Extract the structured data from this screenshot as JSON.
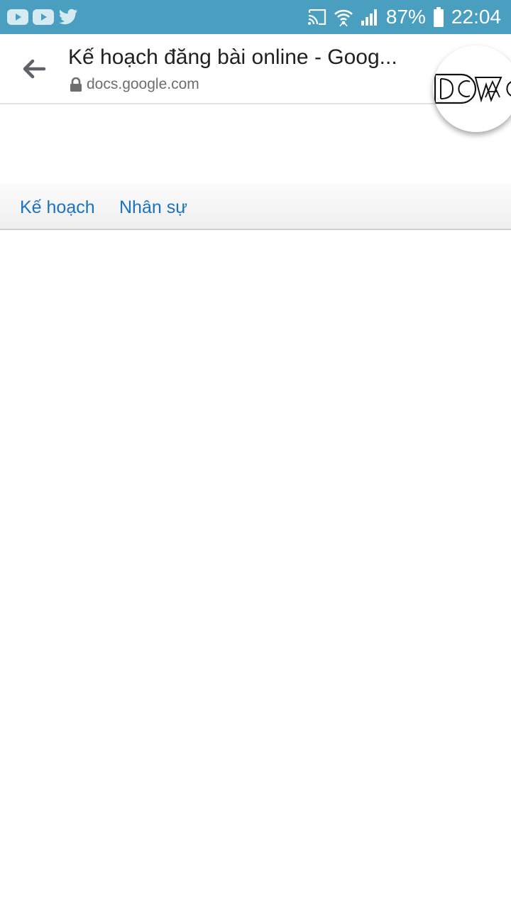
{
  "status_bar": {
    "battery": "87%",
    "time": "22:04",
    "notification_icons": [
      "youtube-icon",
      "youtube-icon",
      "twitter-icon"
    ],
    "system_icons": [
      "cast-icon",
      "wifi-icon",
      "signal-icon",
      "battery-icon"
    ]
  },
  "toolbar": {
    "title": "Kế hoạch đăng bài online - Goog...",
    "url": "docs.google.com",
    "back_icon": "back-arrow-icon",
    "lock_icon": "lock-icon"
  },
  "chat_head": {
    "logo_text": "DCWAC"
  },
  "sheet_tabs": [
    {
      "label": "Kế hoạch"
    },
    {
      "label": "Nhân sự"
    }
  ],
  "colors": {
    "status_bar": "#4a9fc0",
    "tab_link": "#1a73c2"
  }
}
